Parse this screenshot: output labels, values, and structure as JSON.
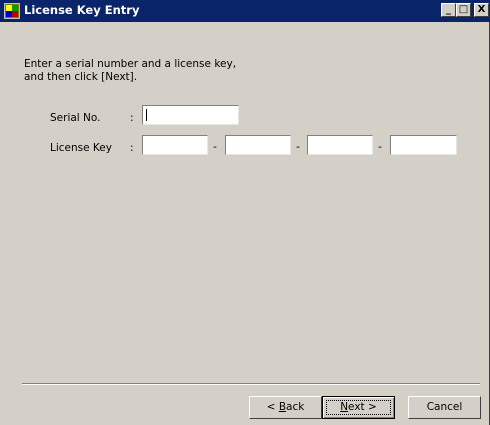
{
  "window": {
    "title": "License Key Entry",
    "controls": {
      "minimize": "_",
      "maximize": "□",
      "close": "X"
    }
  },
  "instruction": {
    "line1": "Enter a serial number and a license key,",
    "line2": "and then click [Next]."
  },
  "form": {
    "serial_label": "Serial No.",
    "serial_colon": ":",
    "serial_value": "",
    "license_label": "License Key",
    "license_colon": ":",
    "license_parts": [
      "",
      "",
      "",
      ""
    ],
    "separator": "-"
  },
  "buttons": {
    "back_prefix": "< ",
    "back_mnemonic": "B",
    "back_rest": "ack",
    "next_mnemonic": "N",
    "next_rest": "ext >",
    "cancel": "Cancel"
  },
  "icons": {
    "app": "license-key-app-icon"
  },
  "colors": {
    "titlebar": "#0a246a",
    "window": "#d4d0c8"
  }
}
